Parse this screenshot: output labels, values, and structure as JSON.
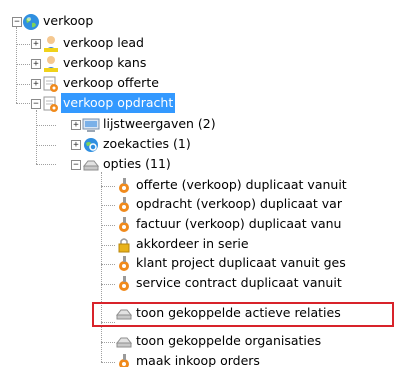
{
  "tree": {
    "root": {
      "label": "verkoop",
      "icon": "globe-icon",
      "expanded": true
    },
    "items": [
      {
        "key": "lead",
        "label": "verkoop lead",
        "icon": "person-icon"
      },
      {
        "key": "kans",
        "label": "verkoop kans",
        "icon": "person-icon"
      },
      {
        "key": "offerte",
        "label": "verkoop offerte",
        "icon": "document-gear-icon"
      },
      {
        "key": "opdracht",
        "label": "verkoop opdracht",
        "icon": "document-gear-icon",
        "selected": true,
        "expanded": true
      }
    ],
    "opdracht_children": [
      {
        "key": "lijstweergaven",
        "label": "lijstweergaven (2)",
        "icon": "monitor-icon"
      },
      {
        "key": "zoekacties",
        "label": "zoekacties (1)",
        "icon": "search-globe-icon"
      },
      {
        "key": "opties",
        "label": "opties (11)",
        "icon": "drawer-icon",
        "expanded": true
      }
    ],
    "opties_children": [
      {
        "key": "offerte-dup",
        "label": "offerte (verkoop) duplicaat vanuit",
        "icon": "gear-wrench-icon"
      },
      {
        "key": "opdracht-dup",
        "label": "opdracht (verkoop) duplicaat var",
        "icon": "gear-wrench-icon"
      },
      {
        "key": "factuur-dup",
        "label": "factuur (verkoop) duplicaat vanu",
        "icon": "gear-wrench-icon"
      },
      {
        "key": "akkordeer",
        "label": "akkordeer in serie",
        "icon": "lock-icon"
      },
      {
        "key": "klant-project",
        "label": "klant project duplicaat vanuit ges",
        "icon": "gear-wrench-icon"
      },
      {
        "key": "service-contract",
        "label": "service contract duplicaat vanuit",
        "icon": "gear-wrench-icon"
      },
      {
        "key": "toon-relaties",
        "label": "toon gekoppelde actieve relaties",
        "icon": "drawer-icon",
        "highlighted": true
      },
      {
        "key": "toon-organisaties",
        "label": "toon gekoppelde organisaties",
        "icon": "drawer-icon"
      },
      {
        "key": "inkoop-orders",
        "label": "maak inkoop orders",
        "icon": "gear-wrench-icon"
      }
    ]
  },
  "colors": {
    "selection": "#3399ff",
    "highlight_border": "#d8232a",
    "connector": "#a0a0a0"
  }
}
